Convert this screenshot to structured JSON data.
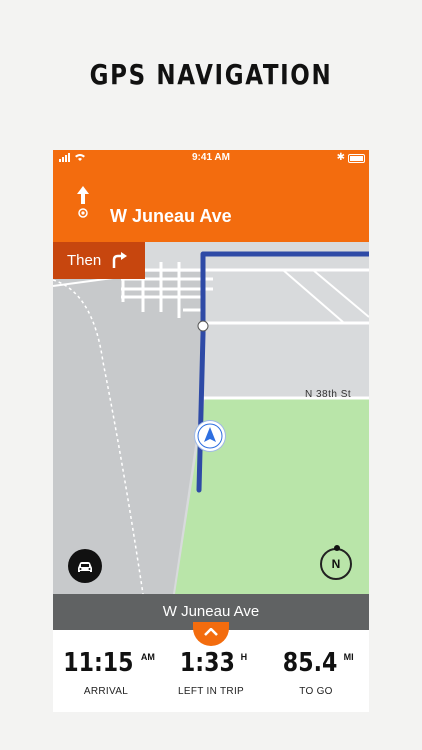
{
  "headline": "GPS NAVIGATION",
  "status_bar": {
    "time": "9:41 AM",
    "bluetooth": "✱"
  },
  "navigation": {
    "next_street": "W Juneau Ave",
    "then_label": "Then",
    "map_street_label": "N 38th St",
    "current_street": "W Juneau Ave",
    "compass_label": "N"
  },
  "trip": {
    "arrival": {
      "value": "11:15",
      "unit": "AM",
      "caption": "ARRIVAL"
    },
    "left": {
      "value": "1:33",
      "unit": "H",
      "caption": "LEFT IN TRIP"
    },
    "distance": {
      "value": "85.4",
      "unit": "MI",
      "caption": "TO GO"
    }
  },
  "colors": {
    "accent": "#f36c0e",
    "accent_dark": "#c7460e",
    "route": "#2e4aa6",
    "park": "#b9e5a9",
    "map_bg": "#d8dadc"
  },
  "icons": {
    "turn_maneuver": "straight-arrow-icon",
    "then_maneuver": "turn-right-icon",
    "vehicle": "car-icon",
    "compass": "compass-icon",
    "position": "navigation-arrow-icon",
    "expand": "chevron-up-icon"
  }
}
